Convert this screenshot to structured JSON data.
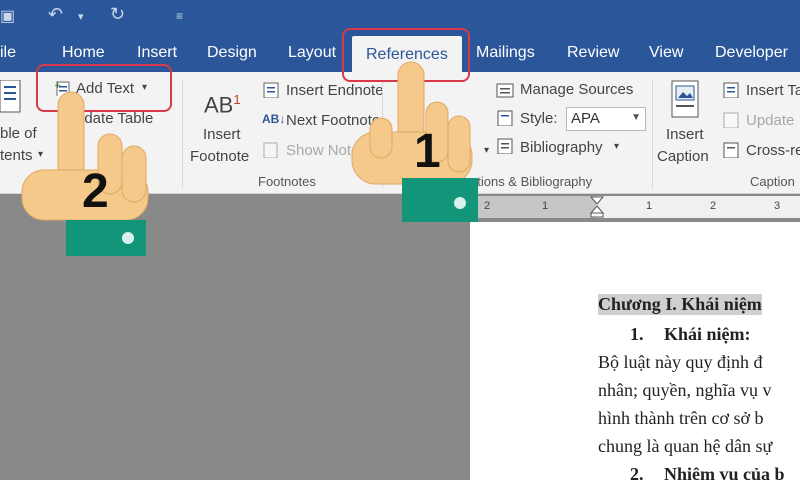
{
  "titlebar": {
    "icons": [
      "save-icon",
      "undo-icon",
      "redo-icon",
      "customize-icon"
    ]
  },
  "tabs": [
    {
      "label": "ile"
    },
    {
      "label": "Home"
    },
    {
      "label": "Insert"
    },
    {
      "label": "Design"
    },
    {
      "label": "Layout"
    },
    {
      "label": "References",
      "active": true
    },
    {
      "label": "Mailings"
    },
    {
      "label": "Review"
    },
    {
      "label": "View"
    },
    {
      "label": "Developer"
    }
  ],
  "ribbon": {
    "toc": {
      "line1": "ble of",
      "line2": "tents"
    },
    "add_text": "Add Text",
    "update_table": "pdate Table",
    "insert_footnote": {
      "line1": "Insert",
      "line2": "Footnote",
      "icon_text": "AB",
      "sup": "1"
    },
    "insert_endnote": "Insert Endnote",
    "next_footnote": "Next Footnote",
    "show_notes": "Show Notes",
    "manage_sources": "Manage Sources",
    "style_label": "Style:",
    "style_value": "APA",
    "bibliography": "Bibliography",
    "insert_caption": {
      "line1": "Insert",
      "line2": "Caption"
    },
    "insert_table": "Insert Ta",
    "update_table2": "Update",
    "cross_ref": "Cross-re",
    "groups": {
      "footnotes": "Footnotes",
      "citations": "ations & Bibliography",
      "captions": "Caption"
    }
  },
  "ruler": {
    "marks": [
      "2",
      "1",
      "1",
      "2",
      "3"
    ]
  },
  "document": {
    "line1": "Chương I. Khái niệm",
    "line2_num": "1.",
    "line2": "Khái niệm:",
    "line3": "Bộ luật này quy định đ",
    "line4": "nhân; quyền, nghĩa vụ v",
    "line5": "hình thành trên cơ sở b",
    "line6": "chung là quan hệ dân sự",
    "line7_num": "2.",
    "line7": "Nhiệm vụ của b"
  },
  "steps": {
    "one": "1",
    "two": "2"
  },
  "colors": {
    "accent": "#2b579a",
    "highlight": "#d93a4a",
    "hand": "#f5c98a",
    "cuff": "#13957a"
  }
}
